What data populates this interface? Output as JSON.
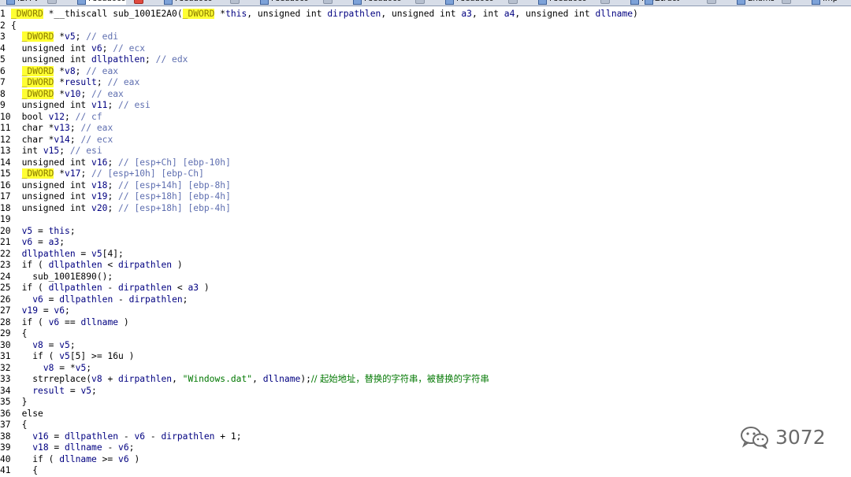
{
  "tabs": [
    {
      "label": "IDA V",
      "active": false
    },
    {
      "label": "Pseudoco",
      "active": true
    },
    {
      "label": "Pseudoco",
      "active": false
    },
    {
      "label": "Pseudoco",
      "active": false
    },
    {
      "label": "Pseudoco",
      "active": false
    },
    {
      "label": "Pseudoco",
      "active": false
    },
    {
      "label": "Pseudoco",
      "active": false
    },
    {
      "label": "Hex V",
      "active": false
    },
    {
      "label": "Struct",
      "active": false
    },
    {
      "label": "Enums",
      "active": false
    },
    {
      "label": "Imp",
      "active": false
    }
  ],
  "code_lines": [
    "_DWORD *__thiscall sub_1001E2A0(_DWORD *this, unsigned int dirpathlen, unsigned int a3, int a4, unsigned int dllname)",
    "{",
    "  _DWORD *v5; // edi",
    "  unsigned int v6; // ecx",
    "  unsigned int dllpathlen; // edx",
    "  _DWORD *v8; // eax",
    "  _DWORD *result; // eax",
    "  _DWORD *v10; // eax",
    "  unsigned int v11; // esi",
    "  bool v12; // cf",
    "  char *v13; // eax",
    "  char *v14; // ecx",
    "  int v15; // esi",
    "  unsigned int v16; // [esp+Ch] [ebp-10h]",
    "  _DWORD *v17; // [esp+10h] [ebp-Ch]",
    "  unsigned int v18; // [esp+14h] [ebp-8h]",
    "  unsigned int v19; // [esp+18h] [ebp-4h]",
    "  unsigned int v20; // [esp+18h] [ebp-4h]",
    "",
    "  v5 = this;",
    "  v6 = a3;",
    "  dllpathlen = v5[4];",
    "  if ( dllpathlen < dirpathlen )",
    "    sub_1001E890();",
    "  if ( dllpathlen - dirpathlen < a3 )",
    "    v6 = dllpathlen - dirpathlen;",
    "  v19 = v6;",
    "  if ( v6 == dllname )",
    "  {",
    "    v8 = v5;",
    "    if ( v5[5] >= 16u )",
    "      v8 = *v5;",
    "    strreplace(v8 + dirpathlen, \"Windows.dat\", dllname);// 起始地址，替换的字符串，被替换的字符串",
    "    result = v5;",
    "  }",
    "  else",
    "  {",
    "    v16 = dllpathlen - v6 - dirpathlen + 1;",
    "    v18 = dllname - v6;",
    "    if ( dllname >= v6 )",
    "    {"
  ],
  "watermark": {
    "icon": "wechat-icon",
    "text": "3072"
  },
  "colors": {
    "highlight": "#ffff33",
    "keyword": "#000080",
    "comment": "#5f6fb0",
    "string": "#007700"
  }
}
